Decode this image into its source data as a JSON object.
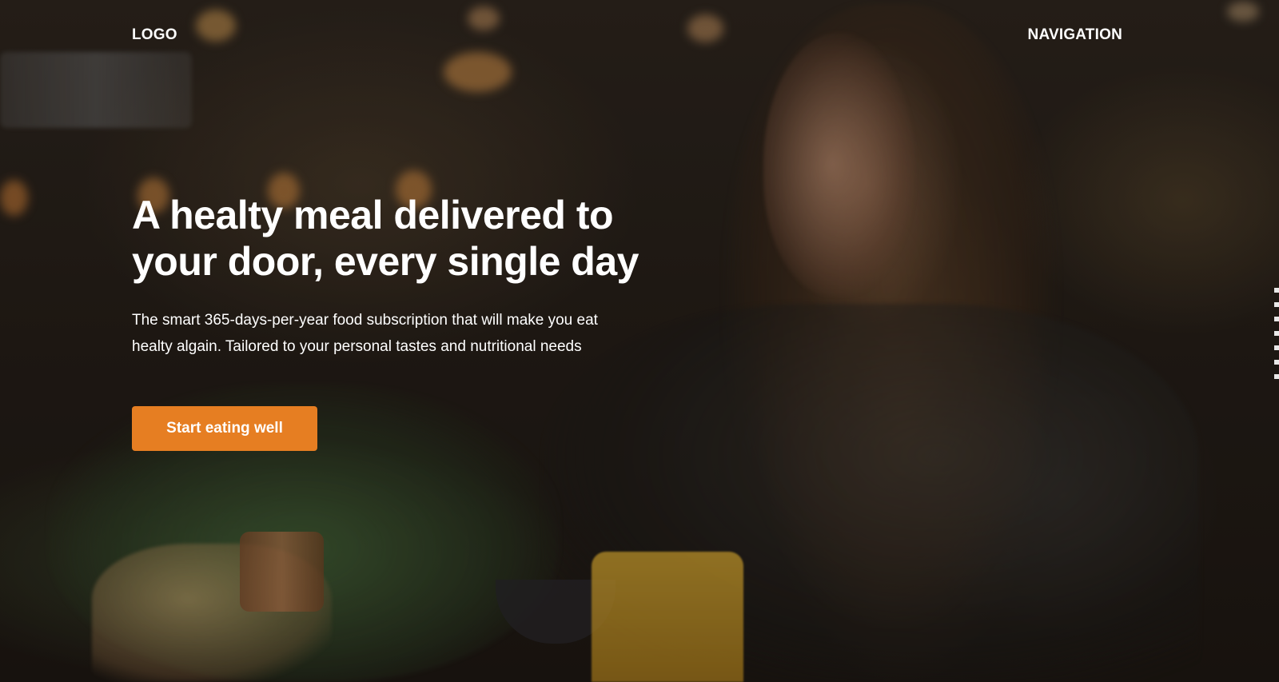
{
  "header": {
    "logo": "LOGO",
    "navigation": "NAVIGATION"
  },
  "hero": {
    "title": "A healty meal delivered to your door, every single day",
    "subtitle": "The smart 365-days-per-year food subscription that will make you eat healty algain. Tailored to your personal tastes and nutritional needs",
    "cta_label": "Start eating well"
  },
  "colors": {
    "accent": "#e67e22",
    "text": "#ffffff"
  }
}
